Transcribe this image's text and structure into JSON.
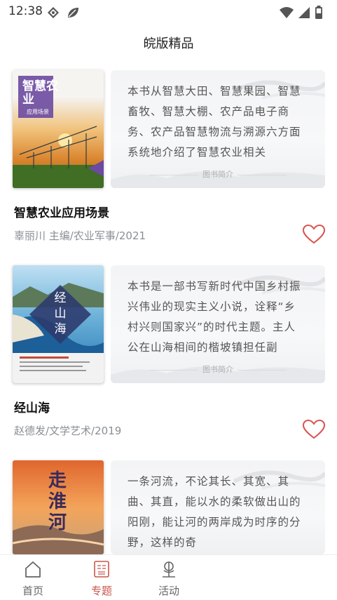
{
  "status_bar": {
    "time": "12:38"
  },
  "header": {
    "title": "皖版精品"
  },
  "books": [
    {
      "title": "智慧农业应用场景",
      "meta": "辜丽川 主编/农业军事/2021",
      "intro": "本书从智慧大田、智慧果园、智慧畜牧、智慧大棚、农产品电子商务、农产品智慧物流与溯源六方面系统地介绍了智慧农业相关",
      "intro_tag": "图书简介",
      "cover_text": {
        "title": "智慧农业",
        "subtitle": "应用场景"
      }
    },
    {
      "title": "经山海",
      "meta": "赵德发/文学艺术/2019",
      "intro": "本书是一部书写新时代中国乡村振兴伟业的现实主义小说，诠释“乡村兴则国家兴”的时代主题。主人公在山海相间的楷坡镇担任副",
      "intro_tag": "图书简介",
      "cover_text": {
        "title": "经山海"
      }
    },
    {
      "title": "",
      "meta": "",
      "intro": "一条河流，不论其长、其宽、其曲、其直，能以水的柔软做出山的阳刚，能让河的两岸成为时序的分野，这样的奇",
      "intro_tag": "",
      "cover_text": {
        "title": "走淮河"
      }
    }
  ],
  "tab_bar": {
    "tabs": [
      {
        "label": "首页",
        "icon": "home-icon"
      },
      {
        "label": "专题",
        "icon": "topic-icon"
      },
      {
        "label": "活动",
        "icon": "activity-icon"
      }
    ]
  },
  "colors": {
    "accent": "#c9554a",
    "meta_text": "#8a8f96",
    "heart": "#d9534f"
  }
}
